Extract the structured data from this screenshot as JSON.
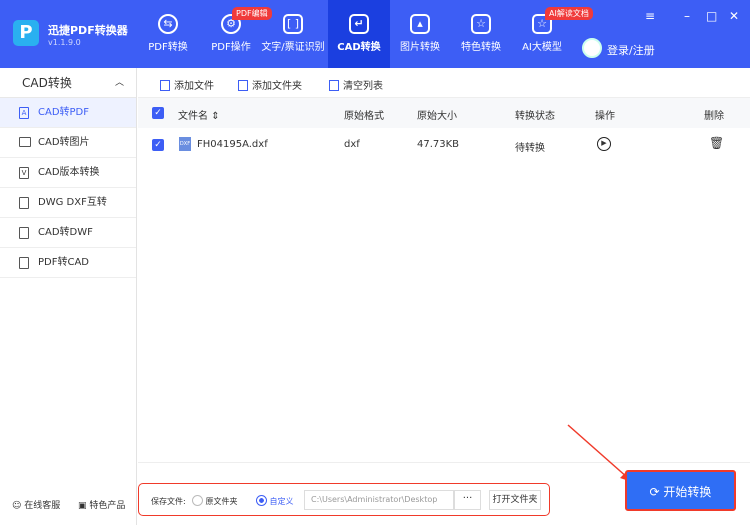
{
  "app": {
    "name": "迅捷PDF转换器",
    "version": "v1.1.9.0"
  },
  "nav": [
    {
      "label": "PDF转换"
    },
    {
      "label": "PDF操作",
      "badge": "PDF编辑"
    },
    {
      "label": "文字/票证识别"
    },
    {
      "label": "CAD转换"
    },
    {
      "label": "图片转换"
    },
    {
      "label": "特色转换"
    },
    {
      "label": "AI大模型",
      "badge": "AI解读文档"
    }
  ],
  "login": "登录/注册",
  "sidebar": {
    "title": "CAD转换",
    "items": [
      "CAD转PDF",
      "CAD转图片",
      "CAD版本转换",
      "DWG DXF互转",
      "CAD转DWF",
      "PDF转CAD"
    ],
    "footer": [
      "在线客服",
      "特色产品"
    ]
  },
  "toolbar": {
    "add_file": "添加文件",
    "add_folder": "添加文件夹",
    "clear": "清空列表"
  },
  "table": {
    "headers": [
      "文件名",
      "原始格式",
      "原始大小",
      "转换状态",
      "操作",
      "删除"
    ],
    "rows": [
      {
        "name": "FH04195A.dxf",
        "format": "dxf",
        "size": "47.73KB",
        "status": "待转换"
      }
    ]
  },
  "save": {
    "label": "保存文件:",
    "opt1": "原文件夹",
    "opt2": "自定义",
    "path": "C:\\Users\\Administrator\\Desktop",
    "dots": "···",
    "open": "打开文件夹"
  },
  "start": "开始转换"
}
